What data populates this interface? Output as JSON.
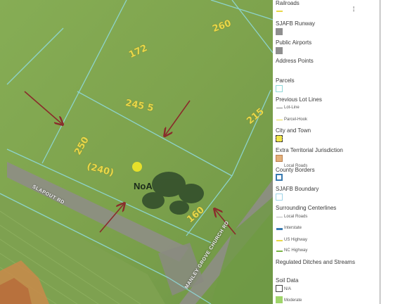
{
  "map": {
    "parcel_labels": [
      "260",
      "172",
      "245 5",
      "215",
      "250",
      "(240)",
      "160"
    ],
    "roads": [
      "SLAPOUT RD",
      "MANLEY GROVE CHURCH RD"
    ],
    "soil_label": "NoA",
    "colors": {
      "field": "#7fa64e",
      "field_dark": "#6e9444",
      "road": "#8e8e85",
      "parcel_line": "#8fd8d8",
      "arrow": "#8a2b2b",
      "parcel_number": "#e8d84a"
    }
  },
  "legend": {
    "items": [
      {
        "title": "Railroads",
        "symbol": "line-yellow"
      },
      {
        "title": "SJAFB Runway",
        "symbol": "box-gray"
      },
      {
        "title": "Public Airports",
        "symbol": "box-gray"
      },
      {
        "title": "Address Points",
        "symbol": "none"
      },
      {
        "title": "Parcels",
        "symbol": "box-cyan-outline"
      },
      {
        "title": "Previous Lot Lines",
        "symbol": "none"
      },
      {
        "title": "City and Town",
        "symbol": "box-yellow-dashed"
      },
      {
        "title": "Extra Territorial Jurisdiction",
        "symbol": "box-orange"
      },
      {
        "title": "County Borders",
        "symbol": "box-blue-outline"
      },
      {
        "title": "SJAFB Boundary",
        "symbol": "box-lightblue-outline"
      },
      {
        "title": "Surrounding Centerlines",
        "symbol": "none"
      },
      {
        "title": "Regulated Ditches and Streams",
        "symbol": "none"
      },
      {
        "title": "Soil Data",
        "symbol": "none"
      }
    ],
    "sub_items": {
      "lot_line": "Lot-Line",
      "parcel_hook": "Parcel-Hook",
      "local_roads": "Local Roads",
      "interstate": "Interstate",
      "us_highway": "US Highway",
      "nc_highway": "NC Highway",
      "soil_na": "N/A",
      "soil_moderate": "Moderate"
    }
  }
}
